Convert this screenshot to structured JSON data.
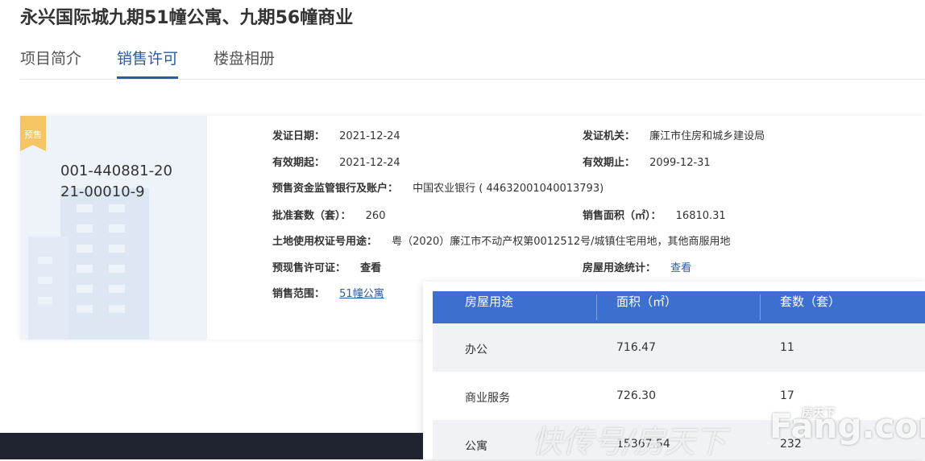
{
  "page_title": "永兴国际城九期51幢公寓、九期56幢商业",
  "tabs": [
    {
      "label": "项目简介",
      "active": false
    },
    {
      "label": "销售许可",
      "active": true
    },
    {
      "label": "楼盘相册",
      "active": false
    }
  ],
  "colors": {
    "accent": "#2d5aa0",
    "badge": "#f5c564",
    "table_header": "#3d6fd1"
  },
  "permit": {
    "badge": "预售",
    "number": "001-440881-2021-00010-9",
    "issue_date_label": "发证日期：",
    "issue_date": "2021-12-24",
    "authority_label": "发证机关：",
    "authority": "廉江市住房和城乡建设局",
    "valid_from_label": "有效期起：",
    "valid_from": "2021-12-24",
    "valid_to_label": "有效期止：",
    "valid_to": "2099-12-31",
    "bank_label": "预售资金监管银行及账户：",
    "bank": "中国农业银行 ( 44632001040013793)",
    "units_label": "批准套数（套）：",
    "units": "260",
    "area_label": "销售面积（㎡）：",
    "area": "16810.31",
    "land_label": "土地使用权证号用途：",
    "land": "粤（2020）廉江市不动产权第0012512号/城镇住宅用地，其他商服用地",
    "presale_label": "预现售许可证：",
    "presale_link": "查看",
    "usage_stats_label": "房屋用途统计：",
    "usage_stats_link": "查看",
    "scope_label": "销售范围：",
    "scope_link": "51幢公寓"
  },
  "usage_table": {
    "headers": [
      "房屋用途",
      "面积（㎡）",
      "套数（套）"
    ],
    "rows": [
      [
        "办公",
        "716.47",
        "11"
      ],
      [
        "商业服务",
        "726.30",
        "17"
      ],
      [
        "公寓",
        "15367.54",
        "232"
      ]
    ]
  },
  "watermark": {
    "text": "快传号/房天下",
    "logo": "Fang.com",
    "logo_small": "房天下"
  }
}
